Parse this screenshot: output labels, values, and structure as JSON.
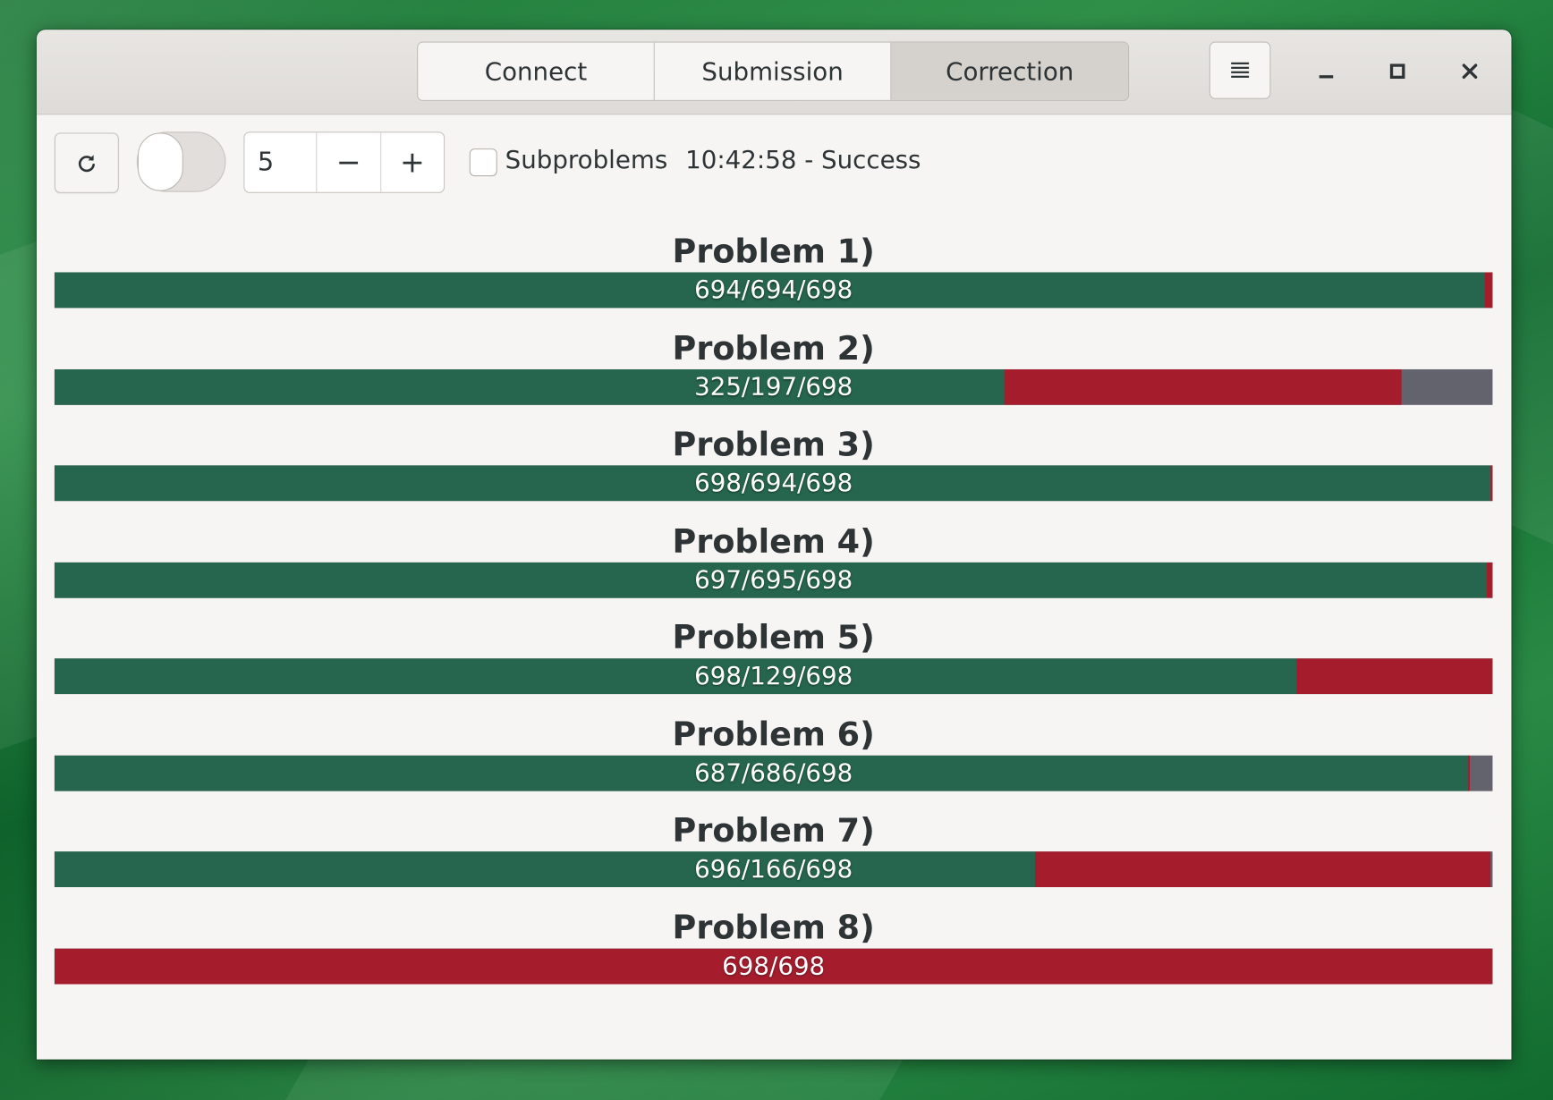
{
  "tabs": [
    {
      "label": "Connect",
      "active": false
    },
    {
      "label": "Submission",
      "active": false
    },
    {
      "label": "Correction",
      "active": true
    }
  ],
  "header": {
    "menu_icon": "hamburger-menu-icon",
    "minimize_icon": "minimize-icon",
    "maximize_icon": "maximize-icon",
    "close_icon": "close-icon"
  },
  "toolbar": {
    "refresh_icon": "refresh-icon",
    "toggle_on": false,
    "spin_value": "5",
    "spin_decrement_label": "−",
    "spin_increment_label": "+",
    "subproblems_label": "Subproblems",
    "subproblems_checked": false,
    "status": "10:42:58 - Success"
  },
  "colors": {
    "correct": "#26654e",
    "wrong": "#a51d2d",
    "pending": "#63636e"
  },
  "problems": [
    {
      "title": "Problem 1)",
      "label": "694/694/698",
      "ok": 694,
      "bad": 4,
      "total": 698
    },
    {
      "title": "Problem 2)",
      "label": "325/197/698",
      "ok": 461,
      "bad": 193,
      "total": 698
    },
    {
      "title": "Problem 3)",
      "label": "698/694/698",
      "ok": 697,
      "bad": 1,
      "total": 698
    },
    {
      "title": "Problem 4)",
      "label": "697/695/698",
      "ok": 695,
      "bad": 3,
      "total": 698
    },
    {
      "title": "Problem 5)",
      "label": "698/129/698",
      "ok": 603,
      "bad": 95,
      "total": 698
    },
    {
      "title": "Problem 6)",
      "label": "687/686/698",
      "ok": 686,
      "bad": 1,
      "total": 698
    },
    {
      "title": "Problem 7)",
      "label": "696/166/698",
      "ok": 476,
      "bad": 221,
      "total": 698
    },
    {
      "title": "Problem 8)",
      "label": "698/698",
      "ok": 0,
      "bad": 698,
      "total": 698
    }
  ]
}
